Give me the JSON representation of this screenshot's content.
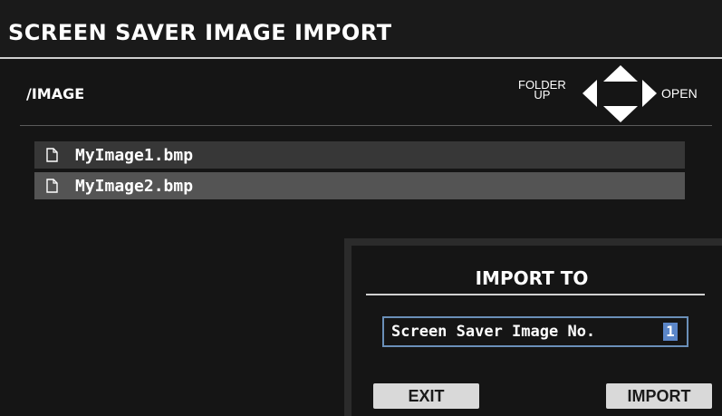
{
  "header": {
    "title": "SCREEN SAVER IMAGE IMPORT"
  },
  "browser": {
    "path": "/IMAGE",
    "nav": {
      "folder_up_line1": "FOLDER",
      "folder_up_line2": "UP",
      "open_label": "OPEN"
    },
    "files": [
      {
        "name": "MyImage1.bmp",
        "icon": "document-icon",
        "selected": false
      },
      {
        "name": "MyImage2.bmp",
        "icon": "document-icon",
        "selected": true
      }
    ]
  },
  "dialog": {
    "title": "IMPORT TO",
    "field_label": "Screen Saver Image No.",
    "field_value": "1",
    "exit_label": "EXIT",
    "import_label": "IMPORT"
  },
  "colors": {
    "background": "#151515",
    "selected_row": "#545454",
    "row": "#373737",
    "value_highlight": "#5b86c8",
    "button": "#d9d9d9"
  }
}
